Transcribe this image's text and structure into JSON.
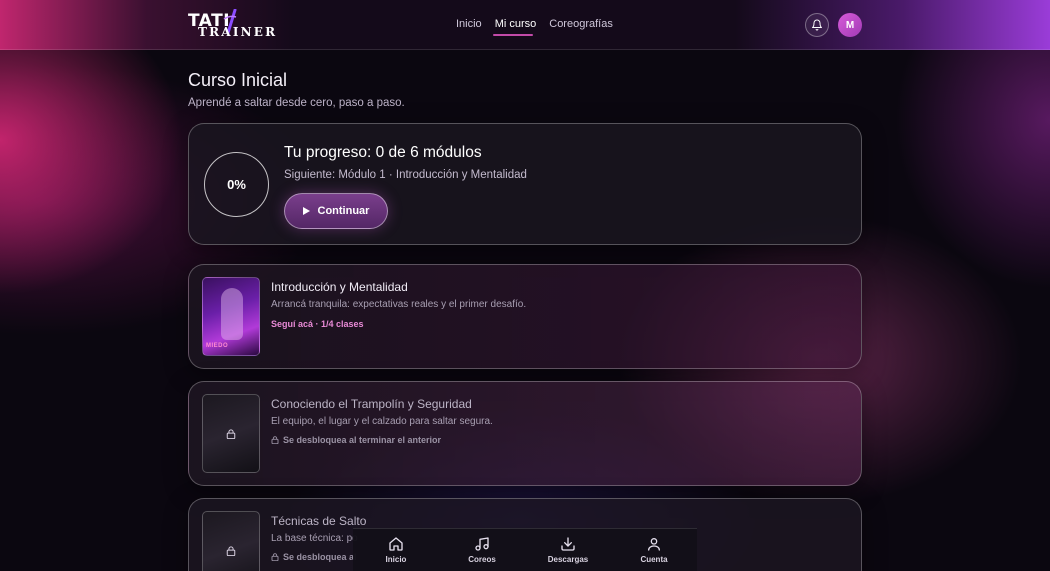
{
  "header": {
    "logo_top": "TATI",
    "logo_bottom": "TRAINER",
    "nav": [
      "Inicio",
      "Mi curso",
      "Coreografías"
    ],
    "active_nav": "Mi curso",
    "avatar_initial": "M"
  },
  "page": {
    "title": "Curso Inicial",
    "subtitle": "Aprendé a saltar desde cero, paso a paso."
  },
  "progress": {
    "percent_label": "0%",
    "percent_value": 0,
    "title": "Tu progreso: 0 de 6 módulos",
    "next": "Siguiente: Módulo 1 · Introducción y Mentalidad",
    "button_label": "Continuar"
  },
  "modules": [
    {
      "title": "Introducción y Mentalidad",
      "description": "Arrancá tranquila: expectativas reales y el primer desafío.",
      "status": "Seguí acá · 1/4 clases",
      "thumb_tag": "MIEDO"
    },
    {
      "title": "Conociendo el Trampolín y Seguridad",
      "description": "El equipo, el lugar y el calzado para saltar segura.",
      "lock_text": "Se desbloquea al terminar el anterior"
    },
    {
      "title": "Técnicas de Salto",
      "description": "La base técnica: po",
      "lock_text": "Se desbloquea al"
    }
  ],
  "bottom_nav": [
    {
      "label": "Inicio",
      "icon": "home-icon"
    },
    {
      "label": "Coreos",
      "icon": "music-note-icon"
    },
    {
      "label": "Descargas",
      "icon": "download-icon"
    },
    {
      "label": "Cuenta",
      "icon": "user-icon"
    }
  ],
  "colors": {
    "accent": "#c24aa8",
    "status_pink": "#e88ad6",
    "button": "#6a3480"
  }
}
